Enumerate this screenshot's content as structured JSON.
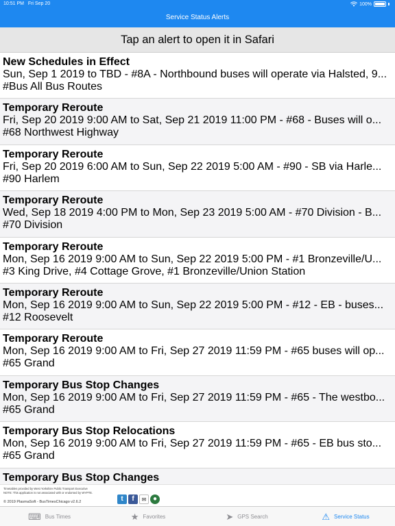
{
  "status_bar": {
    "time": "10:51 PM",
    "date": "Fri Sep 20",
    "battery": "100%"
  },
  "nav": {
    "title": "Service Status Alerts"
  },
  "banner": {
    "text": "Tap an alert to open it in Safari"
  },
  "alerts": [
    {
      "title": "New Schedules in Effect",
      "detail": "Sun, Sep 1 2019 to TBD - #8A - Northbound buses will operate via Halsted, 9...",
      "routes": "#Bus All Bus Routes"
    },
    {
      "title": "Temporary Reroute",
      "detail": "Fri, Sep 20 2019 9:00 AM to Sat, Sep 21 2019 11:00 PM - #68 - Buses will o...",
      "routes": "#68 Northwest Highway"
    },
    {
      "title": "Temporary Reroute",
      "detail": "Fri, Sep 20 2019 6:00 AM to Sun, Sep 22 2019 5:00 AM - #90 - SB via Harle...",
      "routes": "#90 Harlem"
    },
    {
      "title": "Temporary Reroute",
      "detail": "Wed, Sep 18 2019 4:00 PM to Mon, Sep 23 2019 5:00 AM - #70 Division - B...",
      "routes": "#70 Division"
    },
    {
      "title": "Temporary Reroute",
      "detail": "Mon, Sep 16 2019 9:00 AM to Sun, Sep 22 2019 5:00 PM - #1 Bronzeville/U...",
      "routes": "#3 King Drive, #4 Cottage Grove, #1 Bronzeville/Union Station"
    },
    {
      "title": "Temporary Reroute",
      "detail": "Mon, Sep 16 2019 9:00 AM to Sun, Sep 22 2019 5:00 PM - #12 - EB -  buses...",
      "routes": "#12 Roosevelt"
    },
    {
      "title": "Temporary Reroute",
      "detail": "Mon, Sep 16 2019 9:00 AM to Fri, Sep 27 2019 11:59 PM - #65 buses will op...",
      "routes": "#65 Grand"
    },
    {
      "title": "Temporary Bus Stop Changes",
      "detail": "Mon, Sep 16 2019 9:00 AM to Fri, Sep 27 2019 11:59 PM - #65 - The westbo...",
      "routes": "#65 Grand"
    },
    {
      "title": "Temporary Bus Stop Relocations",
      "detail": "Mon, Sep 16 2019 9:00 AM to Fri, Sep 27 2019 11:59 PM - #65 - EB bus sto...",
      "routes": "#65 Grand"
    },
    {
      "title": "Temporary Bus Stop Changes",
      "detail": "",
      "routes": ""
    }
  ],
  "footer": {
    "line1": "Timetables provided by West Yorkshire Public Transport Executive",
    "line2": "NOTE: This application is not associated with or endorsed by WYPTE.",
    "line3": "© 2019 PlasmaSoft - BusTimesChicago v2.6.2"
  },
  "tabs": [
    {
      "label": "Bus Times",
      "icon": "keyboard-icon"
    },
    {
      "label": "Favorites",
      "icon": "star-icon"
    },
    {
      "label": "GPS Search",
      "icon": "location-arrow-icon"
    },
    {
      "label": "Service Status",
      "icon": "warning-icon",
      "active": true
    }
  ],
  "colors": {
    "accent": "#1e88f0",
    "banner_bg": "#e6e6e6",
    "alt_row": "#f4f4f6"
  }
}
